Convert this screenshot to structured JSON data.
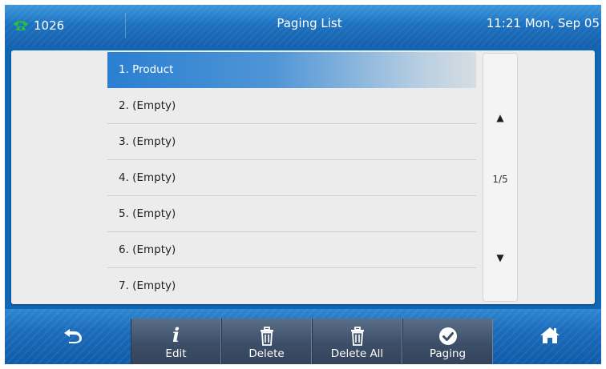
{
  "status_bar": {
    "account": "1026",
    "title": "Paging List",
    "datetime": "11:21 Mon, Sep 05",
    "account_icon": "phone-icon"
  },
  "paging_list": {
    "items": [
      {
        "label": "1. Product",
        "selected": true
      },
      {
        "label": "2. (Empty)",
        "selected": false
      },
      {
        "label": "3. (Empty)",
        "selected": false
      },
      {
        "label": "4. (Empty)",
        "selected": false
      },
      {
        "label": "5. (Empty)",
        "selected": false
      },
      {
        "label": "6. (Empty)",
        "selected": false
      },
      {
        "label": "7. (Empty)",
        "selected": false
      }
    ]
  },
  "scroller": {
    "page": "1/5",
    "up_icon": "triangle-up-icon",
    "down_icon": "triangle-down-icon"
  },
  "softkeys": {
    "back_icon": "back-arrow-icon",
    "home_icon": "home-icon",
    "edit": {
      "label": "Edit",
      "icon": "info-icon"
    },
    "delete": {
      "label": "Delete",
      "icon": "trash-icon"
    },
    "delete_all": {
      "label": "Delete All",
      "icon": "trash-icon"
    },
    "paging": {
      "label": "Paging",
      "icon": "checkmark-circle-icon"
    }
  },
  "colors": {
    "accent": "#1b6cbb",
    "selected_row": "#2a7fd1",
    "softkey_bg": "#3d4f68",
    "account_icon": "#27c13a"
  }
}
